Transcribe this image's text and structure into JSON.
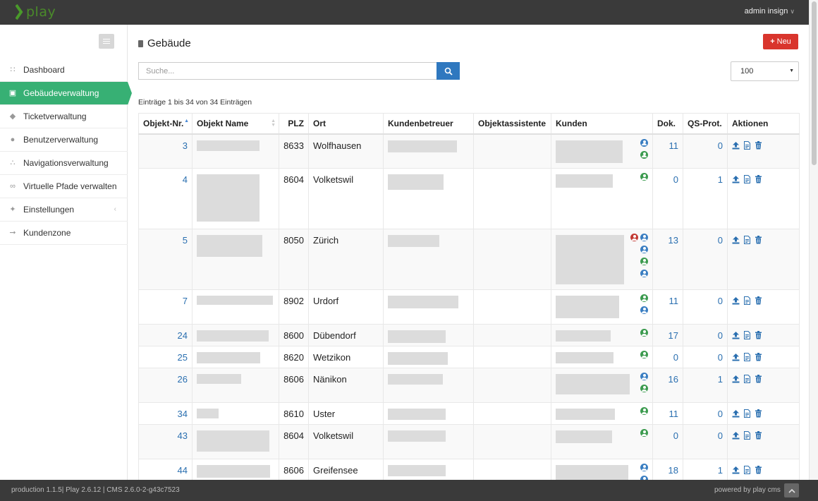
{
  "app": {
    "logo_text": "play",
    "user": "admin insign"
  },
  "sidebar": {
    "items": [
      {
        "label": "Dashboard",
        "icon": "dashboard-icon"
      },
      {
        "label": "Gebäudeverwaltung",
        "icon": "building-icon",
        "active": true
      },
      {
        "label": "Ticketverwaltung",
        "icon": "ticket-icon"
      },
      {
        "label": "Benutzerverwaltung",
        "icon": "user-icon"
      },
      {
        "label": "Navigationsverwaltung",
        "icon": "sitemap-icon"
      },
      {
        "label": "Virtuelle Pfade verwalten",
        "icon": "link-icon"
      },
      {
        "label": "Einstellungen",
        "icon": "wrench-icon"
      },
      {
        "label": "Kundenzone",
        "icon": "arrow-right-icon"
      }
    ]
  },
  "page": {
    "title": "Gebäude",
    "new_button": "Neu"
  },
  "search": {
    "placeholder": "Suche..."
  },
  "page_size": {
    "selected": "100"
  },
  "info_text": "Einträge 1 bis 34 von 34 Einträgen",
  "table": {
    "headers": [
      "Objekt-Nr.",
      "Objekt Name",
      "PLZ",
      "Ort",
      "Kundenbetreuer",
      "Objektassistente",
      "Kunden",
      "Dok.",
      "QS-Prot.",
      "Aktionen"
    ],
    "rows": [
      {
        "nr": "3",
        "plz": "8633",
        "ort": "Wolfhausen",
        "dok": "11",
        "qs": "0"
      },
      {
        "nr": "4",
        "plz": "8604",
        "ort": "Volketswil",
        "dok": "0",
        "qs": "1"
      },
      {
        "nr": "5",
        "plz": "8050",
        "ort": "Zürich",
        "dok": "13",
        "qs": "0"
      },
      {
        "nr": "7",
        "plz": "8902",
        "ort": "Urdorf",
        "dok": "11",
        "qs": "0"
      },
      {
        "nr": "24",
        "plz": "8600",
        "ort": "Dübendorf",
        "dok": "17",
        "qs": "0"
      },
      {
        "nr": "25",
        "plz": "8620",
        "ort": "Wetzikon",
        "dok": "0",
        "qs": "0"
      },
      {
        "nr": "26",
        "plz": "8606",
        "ort": "Nänikon",
        "dok": "16",
        "qs": "1"
      },
      {
        "nr": "34",
        "plz": "8610",
        "ort": "Uster",
        "dok": "11",
        "qs": "0"
      },
      {
        "nr": "43",
        "plz": "8604",
        "ort": "Volketswil",
        "dok": "0",
        "qs": "0"
      },
      {
        "nr": "44",
        "plz": "8606",
        "ort": "Greifensee",
        "dok": "18",
        "qs": "1"
      }
    ]
  },
  "footer": {
    "left": "production 1.1.5| Play 2.6.12 | CMS 2.6.0-2-g43c7523",
    "right": "powered by play cms"
  },
  "colors": {
    "accent": "#37b074",
    "link": "#2a6fb0",
    "danger": "#d9352d",
    "primary": "#2f78bf"
  }
}
